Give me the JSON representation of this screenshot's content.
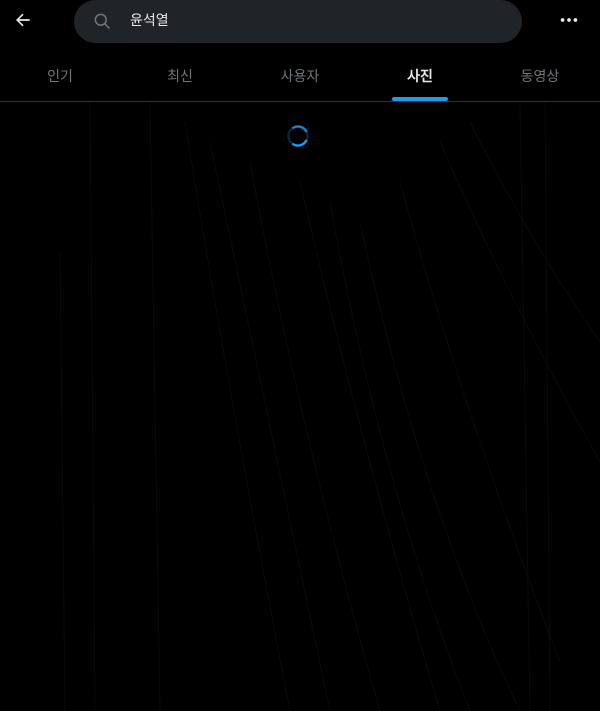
{
  "header": {
    "back_icon": "arrow-left-icon",
    "search": {
      "icon": "search-icon",
      "value": "윤석열",
      "placeholder": ""
    },
    "more_icon": "more-horizontal-icon"
  },
  "tabs": [
    {
      "label": "인기",
      "active": false
    },
    {
      "label": "최신",
      "active": false
    },
    {
      "label": "사용자",
      "active": false
    },
    {
      "label": "사진",
      "active": true
    },
    {
      "label": "동영상",
      "active": false
    }
  ],
  "content": {
    "loading": true,
    "spinner_icon": "loading-spinner-icon"
  },
  "colors": {
    "background": "#000000",
    "search_bg": "#202327",
    "accent": "#1d9bf0",
    "text_primary": "#e7e9ea",
    "text_secondary": "#71767b",
    "divider": "#2f3336"
  }
}
